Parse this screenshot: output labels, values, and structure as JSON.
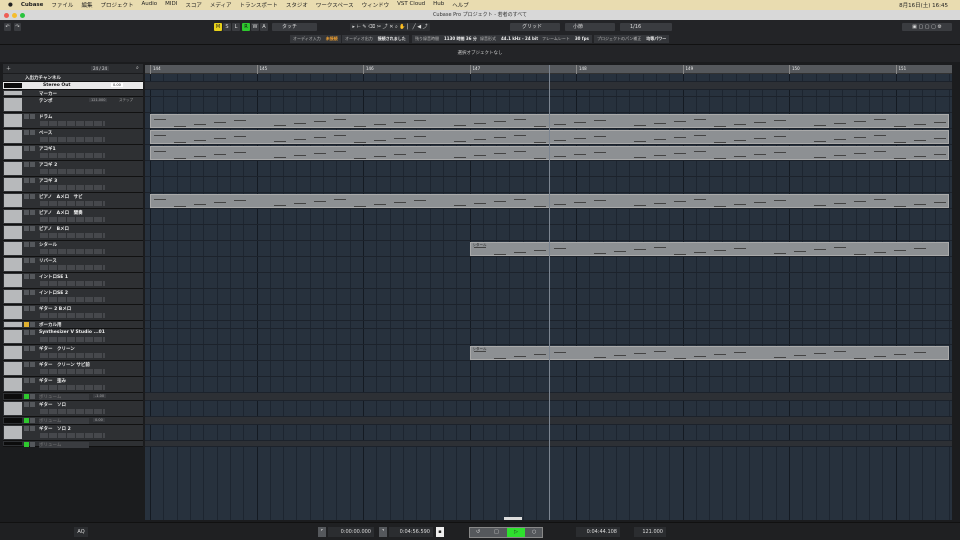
{
  "menubar": {
    "app": "Cubase",
    "items": [
      "ファイル",
      "編集",
      "プロジェクト",
      "Audio",
      "MIDI",
      "スコア",
      "メディア",
      "トランスポート",
      "スタジオ",
      "ワークスペース",
      "ウィンドウ",
      "VST Cloud",
      "Hub",
      "ヘルプ"
    ],
    "clock": "8月16日(土) 16:45"
  },
  "window": {
    "title": "Cubase Pro プロジェクト - 若者のすべて"
  },
  "toolbar": {
    "m": "M",
    "s": "S",
    "l": "L",
    "r": "R",
    "w": "W",
    "a": "A",
    "automation_mode": "タッチ",
    "snap_type": "グリッド",
    "grid": "小節",
    "quantize": "1/16",
    "colors": {
      "m": "#e8d21a",
      "r": "#2ec82e"
    }
  },
  "statusline": [
    {
      "label": "オーディオ入力",
      "value": "未接続"
    },
    {
      "label": "オーディオ出力",
      "value": "接続されました"
    },
    {
      "label": "残り録音時間",
      "value": "1130 時間 36 分"
    },
    {
      "label": "録音形式",
      "value": "44.1 kHz - 24 bit"
    },
    {
      "label": "フレームレート",
      "value": "30 fps"
    },
    {
      "label": "プロジェクトのパン補正",
      "value": "均等パワー"
    }
  ],
  "infoline": "選択オブジェクトなし",
  "tracklist_header": {
    "count": "24 / 24"
  },
  "ruler": [
    "144",
    "145",
    "146",
    "147",
    "148",
    "149",
    "150",
    "151"
  ],
  "tracks": [
    {
      "name": "入出力チャンネル",
      "h": 8,
      "kind": "folder"
    },
    {
      "name": "Stereo Out",
      "h": 8,
      "kind": "out",
      "value": "0.00"
    },
    {
      "name": "マーカー",
      "h": 7,
      "kind": "marker"
    },
    {
      "name": "テンポ",
      "h": 16,
      "kind": "tempo",
      "value": "121.000",
      "mode": "ステップ"
    },
    {
      "name": "ドラム",
      "num": "1",
      "h": 16
    },
    {
      "name": "ベース",
      "num": "2",
      "h": 16
    },
    {
      "name": "アコギ1",
      "num": "3",
      "h": 16
    },
    {
      "name": "アコギ 2",
      "num": "4",
      "h": 16
    },
    {
      "name": "アコギ 3",
      "num": "5",
      "h": 16
    },
    {
      "name": "ピアノ　Aメロ　サビ",
      "num": "6",
      "h": 16
    },
    {
      "name": "ピアノ　Aメロ　間奏",
      "num": "7",
      "h": 16
    },
    {
      "name": "ピアノ　Bメロ",
      "num": "8",
      "h": 16
    },
    {
      "name": "シタール",
      "num": "9",
      "h": 16
    },
    {
      "name": "リバース",
      "num": "10",
      "h": 16
    },
    {
      "name": "イントロSE 1",
      "num": "11",
      "h": 16
    },
    {
      "name": "イントロSE 2",
      "num": "12",
      "h": 16
    },
    {
      "name": "ギター 2 Bメロ",
      "num": "13",
      "h": 16
    },
    {
      "name": "ボーカル用",
      "num": "14",
      "h": 8
    },
    {
      "name": "Synthesizer V Studio ...01",
      "num": "15",
      "h": 16
    },
    {
      "name": "ギター　クリーン",
      "num": "16",
      "h": 16
    },
    {
      "name": "ギター　クリーン サビ前",
      "num": "17",
      "h": 16
    },
    {
      "name": "ギター　歪み",
      "num": "18",
      "h": 16
    },
    {
      "name": "ボリューム",
      "h": 8,
      "kind": "vol",
      "value": "-1.00"
    },
    {
      "name": "ギター　ソロ",
      "num": "19",
      "h": 16
    },
    {
      "name": "ボリューム",
      "h": 8,
      "kind": "vol",
      "value": "0.00"
    },
    {
      "name": "ギター　ソロ 2",
      "num": "20",
      "h": 16
    },
    {
      "name": "ボリューム",
      "h": 6,
      "kind": "vol",
      "value": ""
    }
  ],
  "events": [
    {
      "track": 4,
      "start": 144.0,
      "end": 151.5,
      "label": ""
    },
    {
      "track": 5,
      "start": 144.0,
      "end": 151.5,
      "label": ""
    },
    {
      "track": 6,
      "start": 144.0,
      "end": 151.5,
      "label": ""
    },
    {
      "track": 9,
      "start": 144.0,
      "end": 151.5,
      "label": ""
    },
    {
      "track": 12,
      "start": 147.0,
      "end": 151.5,
      "label": "シタール"
    },
    {
      "track": 19,
      "start": 147.0,
      "end": 151.5,
      "label": "シタール"
    }
  ],
  "transport": {
    "left_locator": "0:00:00.000",
    "right_locator": "0:04:56.590",
    "position": "0:04:44.108",
    "tempo": "121.000",
    "aq": "AQ"
  }
}
